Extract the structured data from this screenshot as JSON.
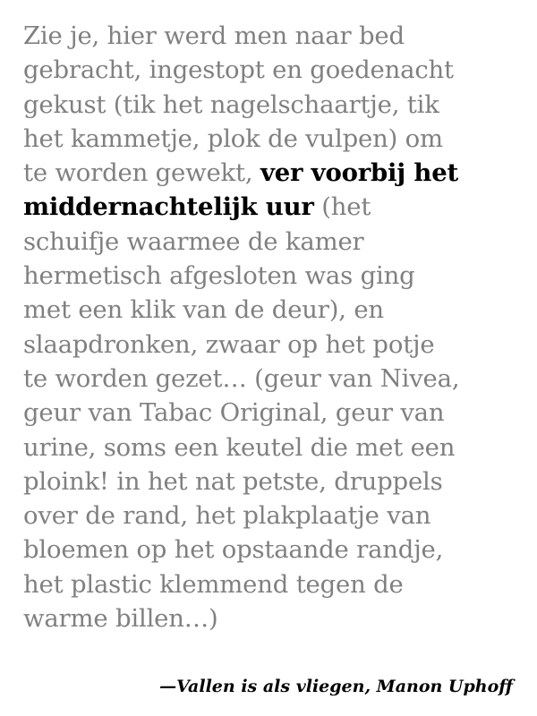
{
  "quote": {
    "lines": [
      "Zie je, hier werd men naar bed",
      "gebracht, ingestopt en goedenacht",
      "gekust (tik het nagelschaartje, tik",
      "het kammetje, plok de vulpen) om",
      "te worden gewekt, ",
      "ver voorbij het",
      "middernachtelijk uur",
      " (het",
      "schuifje waarmee de kamer",
      "hermetisch afgesloten was ging",
      "met een klik van de deur), en",
      "slaapdronken, zwaar op het potje",
      "te worden gezet… (geur van Nivea,",
      "geur van Tabac Original, geur van",
      "urine, soms een keutel die met een",
      "ploink! in het nat petste, druppels",
      "over de rand, het plakplaatje van",
      "bloemen op het opstaande randje,",
      "het plastic klemmend tegen de",
      "warme billen…)"
    ]
  },
  "attribution": "—Vallen is als vliegen, Manon Uphoff",
  "colors": {
    "body_text": "#808080",
    "emphasis_text": "#000000",
    "background": "#ffffff"
  }
}
